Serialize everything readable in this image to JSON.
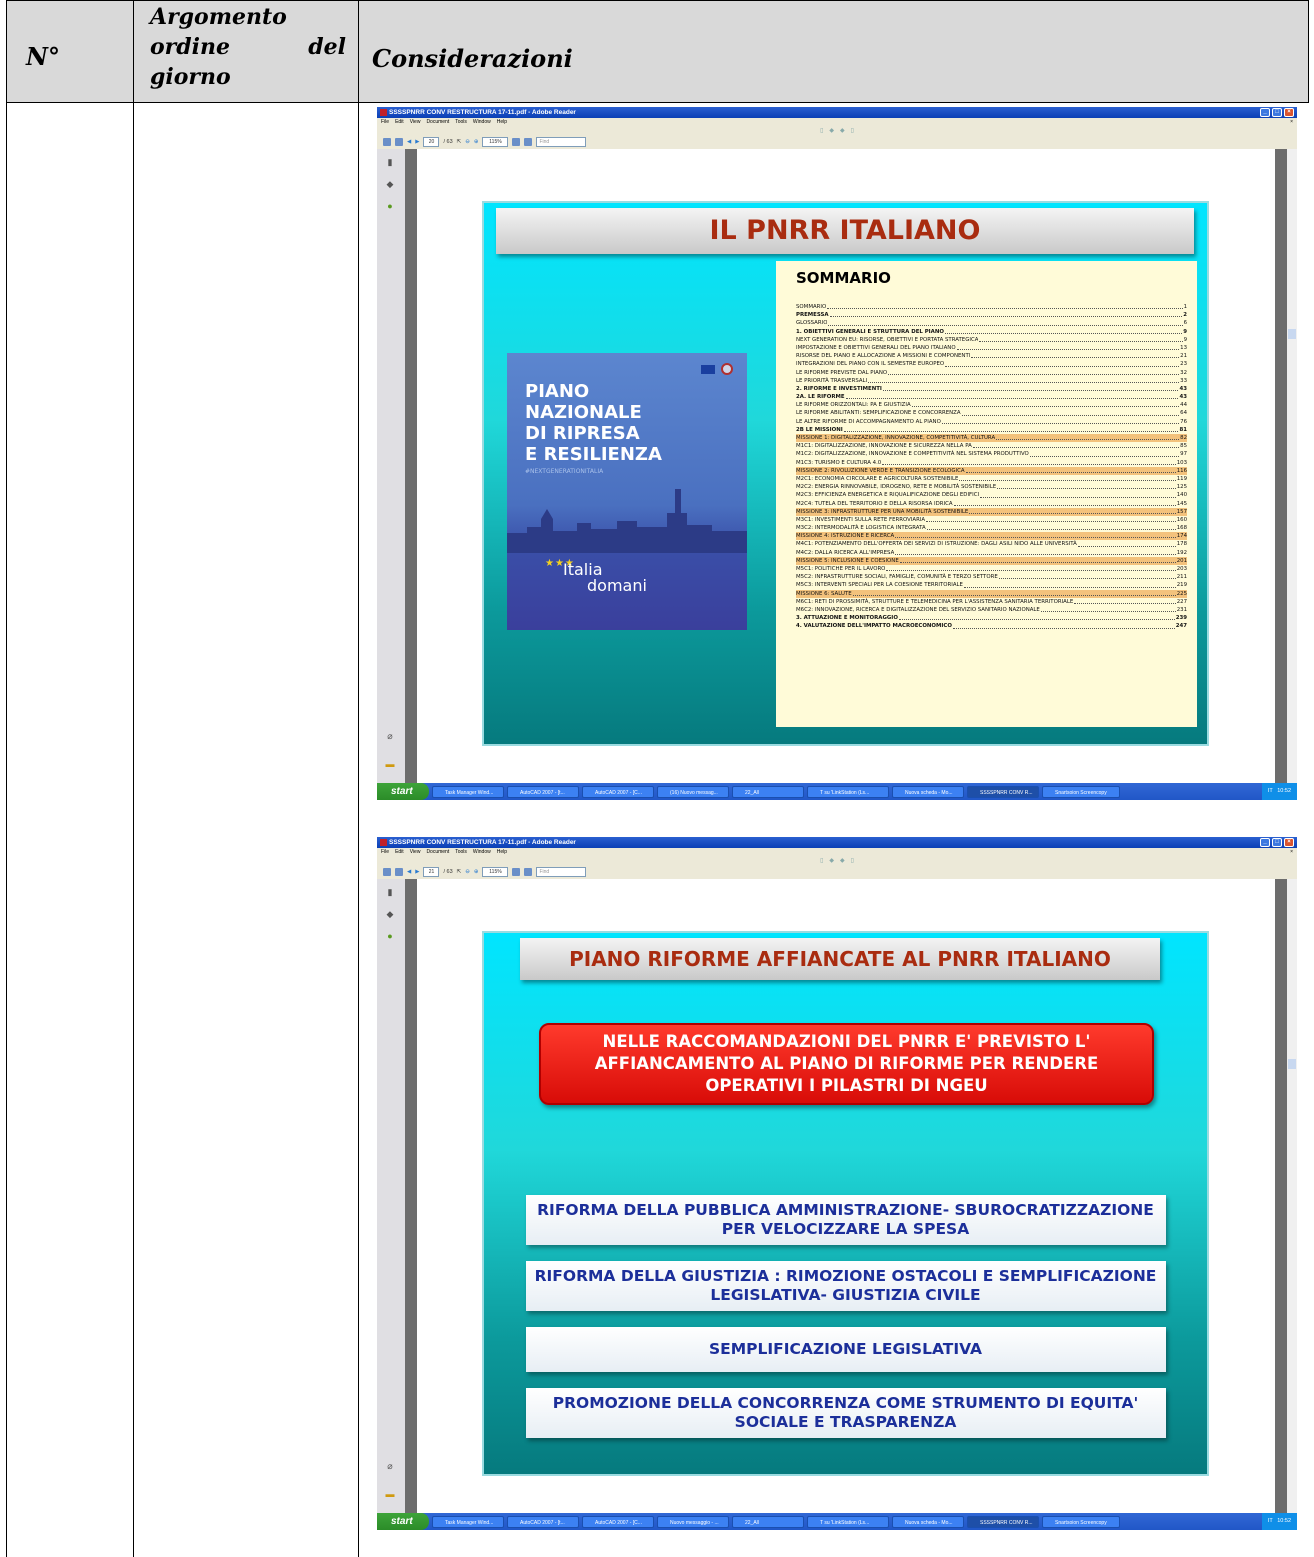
{
  "table": {
    "headers": {
      "n": "N°",
      "argomento": "Argomento ordine del giorno",
      "considerazioni": "Considerazioni"
    }
  },
  "window1": {
    "title": "SSSSPNRR CONV RESTRUCTURA 17-11.pdf - Adobe Reader",
    "menu": [
      "File",
      "Edit",
      "View",
      "Document",
      "Tools",
      "Window",
      "Help"
    ],
    "page_current": "20",
    "page_total": "/ 63",
    "zoom": "115%",
    "find_placeholder": "Find",
    "slide": {
      "title": "IL PNRR ITALIANO",
      "cover": {
        "lines": [
          "PIANO",
          "NAZIONALE",
          "DI RIPRESA",
          "E RESILIENZA"
        ],
        "hashtag": "#NEXTGENERATIONITALIA",
        "logo_top": "Italia",
        "logo_bottom": "domani"
      },
      "sommario_title": "SOMMARIO",
      "toc": [
        {
          "t": "SOMMARIO",
          "p": "1",
          "s": ""
        },
        {
          "t": "PREMESSA",
          "p": "2",
          "s": "b"
        },
        {
          "t": "GLOSSARIO",
          "p": "6",
          "s": ""
        },
        {
          "t": "1.    OBIETTIVI GENERALI E STRUTTURA DEL PIANO",
          "p": "9",
          "s": "b"
        },
        {
          "t": "NEXT GENERATION EU: RISORSE, OBIETTIVI E PORTATA STRATEGICA",
          "p": "9",
          "s": ""
        },
        {
          "t": "IMPOSTAZIONE E OBIETTIVI GENERALI DEL PIANO ITALIANO",
          "p": "13",
          "s": ""
        },
        {
          "t": "RISORSE DEL PIANO E ALLOCAZIONE A MISSIONI E COMPONENTI",
          "p": "21",
          "s": ""
        },
        {
          "t": "INTEGRAZIONI DEL PIANO CON IL SEMESTRE EUROPEO",
          "p": "23",
          "s": ""
        },
        {
          "t": "LE RIFORME PREVISTE DAL PIANO",
          "p": "32",
          "s": ""
        },
        {
          "t": "LE PRIORITÀ TRASVERSALI",
          "p": "33",
          "s": ""
        },
        {
          "t": "2.    RIFORME E INVESTIMENTI",
          "p": "43",
          "s": "b"
        },
        {
          "t": "2A. LE RIFORME",
          "p": "43",
          "s": "b"
        },
        {
          "t": "LE RIFORME ORIZZONTALI: PA E GIUSTIZIA",
          "p": "44",
          "s": ""
        },
        {
          "t": "LE RIFORME ABILITANTI: SEMPLIFICAZIONE E CONCORRENZA",
          "p": "64",
          "s": ""
        },
        {
          "t": "LE ALTRE RIFORME DI ACCOMPAGNAMENTO AL PIANO",
          "p": "76",
          "s": ""
        },
        {
          "t": "2B   LE MISSIONI",
          "p": "81",
          "s": "b"
        },
        {
          "t": "MISSIONE 1: DIGITALIZZAZIONE, INNOVAZIONE, COMPETITIVITÀ, CULTURA",
          "p": "82",
          "s": "h"
        },
        {
          "t": "M1C1: DIGITALIZZAZIONE, INNOVAZIONE E SICUREZZA NELLA PA",
          "p": "85",
          "s": ""
        },
        {
          "t": "M1C2: DIGITALIZZAZIONE, INNOVAZIONE E COMPETITIVITÀ NEL SISTEMA PRODUTTIVO",
          "p": "97",
          "s": ""
        },
        {
          "t": "M1C3: TURISMO E CULTURA 4.0",
          "p": "103",
          "s": ""
        },
        {
          "t": "MISSIONE 2: RIVOLUZIONE VERDE E TRANSIZIONE ECOLOGICA",
          "p": "116",
          "s": "h"
        },
        {
          "t": "M2C1: ECONOMIA CIRCOLARE E AGRICOLTURA SOSTENIBILE",
          "p": "119",
          "s": ""
        },
        {
          "t": "M2C2: ENERGIA RINNOVABILE, IDROGENO, RETE E MOBILITÀ SOSTENIBILE",
          "p": "125",
          "s": ""
        },
        {
          "t": "M2C3: EFFICIENZA ENERGETICA E RIQUALIFICAZIONE DEGLI EDIFICI",
          "p": "140",
          "s": ""
        },
        {
          "t": "M2C4: TUTELA DEL TERRITORIO E DELLA RISORSA IDRICA",
          "p": "145",
          "s": ""
        },
        {
          "t": "MISSIONE 3: INFRASTRUTTURE PER UNA MOBILITÀ SOSTENIBILE",
          "p": "157",
          "s": "h"
        },
        {
          "t": "M3C1: INVESTIMENTI SULLA RETE FERROVIARIA",
          "p": "160",
          "s": ""
        },
        {
          "t": "M3C2: INTERMODALITÀ E LOGISTICA INTEGRATA",
          "p": "168",
          "s": ""
        },
        {
          "t": "MISSIONE 4: ISTRUZIONE E RICERCA",
          "p": "174",
          "s": "h"
        },
        {
          "t": "M4C1: POTENZIAMENTO DELL'OFFERTA DEI SERVIZI DI ISTRUZIONE: DAGLI ASILI NIDO ALLE UNIVERSITÀ",
          "p": "178",
          "s": ""
        },
        {
          "t": "M4C2: DALLA RICERCA ALL'IMPRESA",
          "p": "192",
          "s": ""
        },
        {
          "t": "MISSIONE 5: INCLUSIONE E COESIONE",
          "p": "201",
          "s": "h"
        },
        {
          "t": "M5C1: POLITICHE PER IL LAVORO",
          "p": "203",
          "s": ""
        },
        {
          "t": "M5C2: INFRASTRUTTURE SOCIALI, FAMIGLIE, COMUNITÀ E TERZO SETTORE",
          "p": "211",
          "s": ""
        },
        {
          "t": "M5C3: INTERVENTI SPECIALI PER LA COESIONE TERRITORIALE",
          "p": "219",
          "s": ""
        },
        {
          "t": "MISSIONE 6: SALUTE",
          "p": "225",
          "s": "h"
        },
        {
          "t": "M6C1: RETI DI PROSSIMITÀ, STRUTTURE E TELEMEDICINA PER L'ASSISTENZA SANITARIA TERRITORIALE",
          "p": "227",
          "s": ""
        },
        {
          "t": "M6C2: INNOVAZIONE, RICERCA E DIGITALIZZAZIONE DEL SERVIZIO SANITARIO NAZIONALE",
          "p": "231",
          "s": ""
        },
        {
          "t": "3.    ATTUAZIONE E MONITORAGGIO",
          "p": "239",
          "s": "b"
        },
        {
          "t": "4.    VALUTAZIONE DELL'IMPATTO MACROECONOMICO",
          "p": "247",
          "s": "b"
        }
      ]
    },
    "taskbar": {
      "start": "start",
      "tasks": [
        "Task Manager Wind...",
        "AutoCAD 2007 - [t...",
        "AutoCAD 2007 - [C...",
        "(16) Nuovo messag...",
        "22_All",
        "T su 'LinkStation (Ls...",
        "Nuova scheda - Mo...",
        "SSSSPNRR CONV R...",
        "Snartsoion Screencopy"
      ],
      "lang": "IT",
      "time": "10:52"
    }
  },
  "window2": {
    "title": "SSSSPNRR CONV RESTRUCTURA 17-11.pdf - Adobe Reader",
    "menu": [
      "File",
      "Edit",
      "View",
      "Document",
      "Tools",
      "Window",
      "Help"
    ],
    "page_current": "21",
    "page_total": "/ 63",
    "zoom": "115%",
    "find_placeholder": "Find",
    "slide": {
      "title": "PIANO RIFORME AFFIANCATE  AL PNRR ITALIANO",
      "red_box": "NELLE RACCOMANDAZIONI DEL PNRR E' PREVISTO L' AFFIANCAMENTO AL PIANO  DI RIFORME PER RENDERE OPERATIVI I PILASTRI DI NGEU",
      "boxes": [
        "RIFORMA DELLA PUBBLICA AMMINISTRAZIONE- SBUROCRATIZZAZIONE PER VELOCIZZARE LA SPESA",
        "RIFORMA DELLA GIUSTIZIA : RIMOZIONE OSTACOLI E SEMPLIFICAZIONE LEGISLATIVA- GIUSTIZIA CIVILE",
        "SEMPLIFICAZIONE LEGISLATIVA",
        "PROMOZIONE DELLA CONCORRENZA COME STRUMENTO DI EQUITA' SOCIALE  E TRASPARENZA"
      ]
    },
    "taskbar": {
      "start": "start",
      "tasks": [
        "Task Manager Wind...",
        "AutoCAD 2007 - [t...",
        "AutoCAD 2007 - [C...",
        "Nuovo messaggio - ...",
        "22_All",
        "T su 'LinkStation (Ls...",
        "Nuova scheda - Mo...",
        "SSSSPNRR CONV R...",
        "Snartsoion Screencopy"
      ],
      "lang": "IT",
      "time": "10:52"
    }
  },
  "colors": {
    "header_bg": "#d9d9d9",
    "slide_cyan": "#00e5ff",
    "title_red": "#a92c10",
    "box_blue": "#1c2f9a",
    "red_box": "#e8140c",
    "cover_blue": "#3e5bb0"
  }
}
